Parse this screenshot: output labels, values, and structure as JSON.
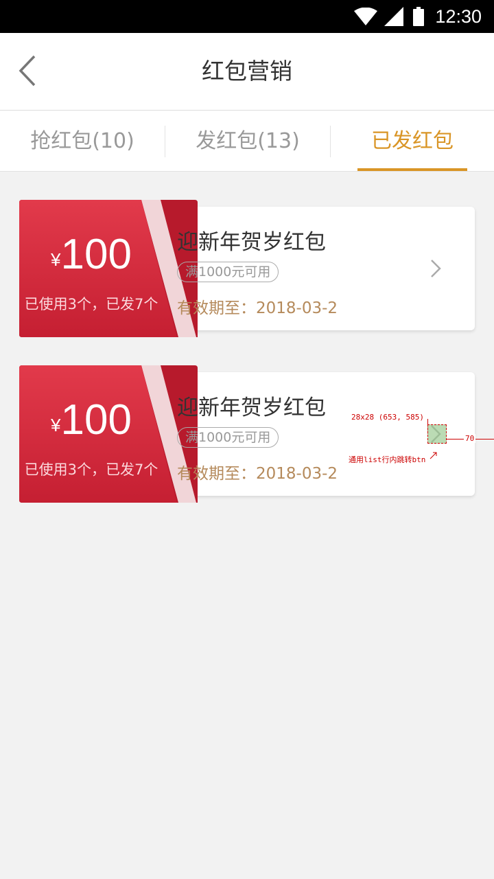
{
  "status_bar": {
    "time": "12:30"
  },
  "nav": {
    "title": "红包营销"
  },
  "tabs": [
    {
      "label": "抢红包(10)"
    },
    {
      "label": "发红包(13)"
    },
    {
      "label": "已发红包",
      "active": true
    }
  ],
  "colors": {
    "accent": "#d99526",
    "ribbon": "#d42b3f",
    "expiry_text": "#b58a5b"
  },
  "cards": [
    {
      "currency": "¥",
      "amount": "100",
      "usage": "已使用3个，已发7个",
      "name": "迎新年贺岁红包",
      "condition": "满1000元可用",
      "expiry": "有效期至：2018-03-2"
    },
    {
      "currency": "¥",
      "amount": "100",
      "usage": "已使用3个，已发7个",
      "name": "迎新年贺岁红包",
      "condition": "满1000元可用",
      "expiry": "有效期至：2018-03-2"
    }
  ],
  "annotation": {
    "size_label": "28x28 (653, 585)",
    "distance_label": "70",
    "note": "通用list行内跳转btn"
  }
}
